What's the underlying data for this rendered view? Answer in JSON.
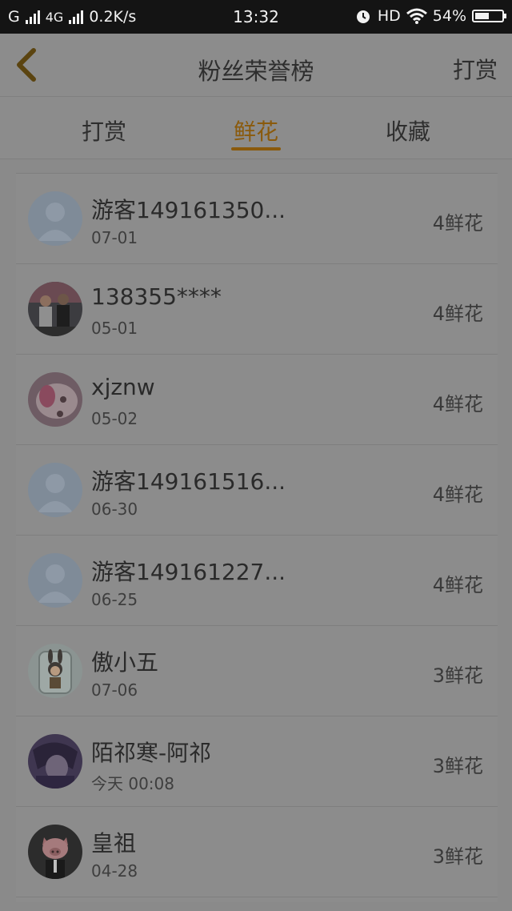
{
  "status_bar": {
    "carrier": "G",
    "network": "4G",
    "speed": "0.2K/s",
    "time": "13:32",
    "hd": "HD",
    "battery": "54%",
    "battery_level": 0.54,
    "icons": [
      "signal-icon",
      "alarm-icon",
      "wifi-icon",
      "battery-icon"
    ]
  },
  "header": {
    "title": "粉丝荣誉榜",
    "action_label": "打赏",
    "back_icon": "chevron-left-icon"
  },
  "tabs": [
    {
      "label": "打赏",
      "active": false
    },
    {
      "label": "鲜花",
      "active": true
    },
    {
      "label": "收藏",
      "active": false
    }
  ],
  "colors": {
    "accent": "#8a5a0c",
    "overlay_bg": "#8c8c8c",
    "statusbar_bg": "#141414"
  },
  "fans": [
    {
      "name": "游客149161350...",
      "date": "07-01",
      "count": "4鲜花",
      "avatar": "default-avatar-icon"
    },
    {
      "name": "138355****",
      "date": "05-01",
      "count": "4鲜花",
      "avatar": "couple-photo-avatar"
    },
    {
      "name": "xjznw",
      "date": "05-02",
      "count": "4鲜花",
      "avatar": "toy-photo-avatar"
    },
    {
      "name": "游客149161516...",
      "date": "06-30",
      "count": "4鲜花",
      "avatar": "default-avatar-icon"
    },
    {
      "name": "游客149161227...",
      "date": "06-25",
      "count": "4鲜花",
      "avatar": "default-avatar-icon"
    },
    {
      "name": "傲小五",
      "date": "07-06",
      "count": "3鲜花",
      "avatar": "bunny-figure-avatar"
    },
    {
      "name": "陌祁寒-阿祁",
      "date": "今天 00:08",
      "count": "3鲜花",
      "avatar": "anime-avatar"
    },
    {
      "name": "皇祖",
      "date": "04-28",
      "count": "3鲜花",
      "avatar": "pig-avatar"
    }
  ]
}
